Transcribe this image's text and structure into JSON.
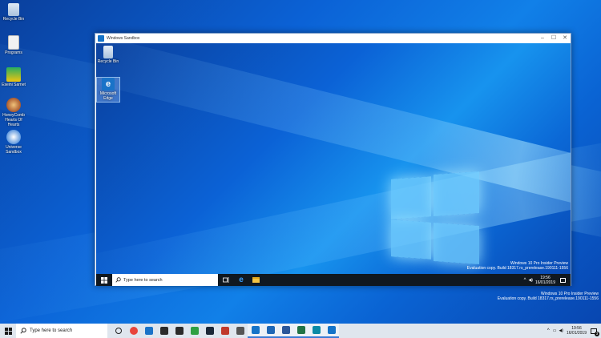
{
  "desktop": {
    "icons": [
      {
        "label": "Recycle Bin"
      },
      {
        "label": "Programs"
      },
      {
        "label": "Eseini Sarnet"
      },
      {
        "label": "HoneyComb Hearts Of Hearts"
      },
      {
        "label": "Universe Sandbox"
      }
    ]
  },
  "sandbox": {
    "title": "Windows Sandbox",
    "controls": {
      "minimize": "–",
      "maximize": "☐",
      "close": "✕"
    },
    "icons": [
      {
        "label": "Recycle Bin"
      },
      {
        "label": "Microsoft Edge"
      }
    ],
    "watermark": {
      "line1": "Windows 10 Pro Insider Preview",
      "line2": "Evaluation copy. Build 18317.rs_prerelease.190111-1556"
    },
    "taskbar": {
      "search_placeholder": "Type here to search",
      "time": "19:56",
      "date": "16/01/2019"
    }
  },
  "host": {
    "watermark": {
      "line1": "Windows 10 Pro Insider Preview",
      "line2": "Evaluation copy. Build 18317.rs_prerelease.190111-1556"
    },
    "taskbar": {
      "search_placeholder": "Type here to search",
      "time": "19:56",
      "date": "16/01/2019",
      "notification_count": "3",
      "apps": [
        {
          "name": "cortana-icon",
          "color": "#222222"
        },
        {
          "name": "chrome-icon",
          "color": "#e8453c"
        },
        {
          "name": "edge-icon",
          "color": "#1a73c8"
        },
        {
          "name": "store-icon",
          "color": "#2b2b2b"
        },
        {
          "name": "mail-icon",
          "color": "#2b2b2b"
        },
        {
          "name": "xbox-icon",
          "color": "#2ea043"
        },
        {
          "name": "steam-icon",
          "color": "#1b2838"
        },
        {
          "name": "game-icon",
          "color": "#c0392b"
        },
        {
          "name": "media-icon",
          "color": "#555555"
        },
        {
          "name": "sandbox-icon",
          "color": "#1473c8"
        },
        {
          "name": "photos-icon",
          "color": "#1e66b5"
        },
        {
          "name": "word-icon",
          "color": "#2b579a"
        },
        {
          "name": "excel-icon",
          "color": "#217346"
        },
        {
          "name": "magnifier-icon",
          "color": "#0b8aa6"
        },
        {
          "name": "sandbox-window-icon",
          "color": "#1473c8"
        }
      ]
    }
  }
}
